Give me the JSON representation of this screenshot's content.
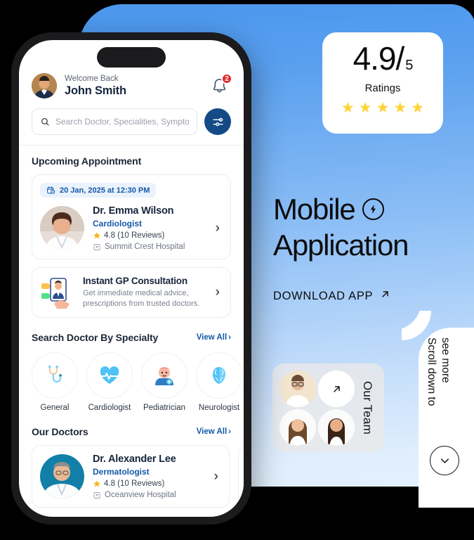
{
  "promo": {
    "ratings": {
      "score": "4.9",
      "separator": "/",
      "out_of": "5",
      "label": "Ratings",
      "stars_count": 5,
      "star_glyph": "★",
      "star_color": "#FFD233"
    },
    "headline_line1": "Mobile",
    "headline_line2": "Application",
    "headline_icon": "bolt-circle-icon",
    "download_cta": "DOWNLOAD APP",
    "download_icon": "arrow-up-right-icon",
    "team": {
      "label": "Our Team",
      "arrow_icon": "arrow-up-right-icon",
      "members": [
        "team-member-1",
        "team-member-2",
        "team-member-3"
      ]
    },
    "scroll_hint": {
      "line1": "Scroll down to",
      "line2": "see more",
      "icon": "chevron-down-icon"
    },
    "colors": {
      "gradient_top": "#4A97EE",
      "gradient_bottom": "#E4F0FD",
      "card_white": "#FFFFFF"
    }
  },
  "app": {
    "header": {
      "welcome_small": "Welcome Back",
      "user_name": "John Smith",
      "avatar": "user-avatar",
      "bell_icon": "bell-icon",
      "notification_count": "2",
      "notification_color": "#E02B2B"
    },
    "search": {
      "placeholder": "Search Doctor, Specialities, Symptoms",
      "value": "",
      "search_icon": "search-icon",
      "filter_icon": "sliders-icon",
      "filter_color": "#144A86"
    },
    "upcoming": {
      "title": "Upcoming Appointment",
      "date_chip": "20 Jan, 2025 at 12:30 PM",
      "date_icon": "calendar-clock-icon",
      "doctor": {
        "name": "Dr. Emma Wilson",
        "specialty": "Cardiologist",
        "rating": "4.8 (10 Reviews)",
        "hospital": "Summit Crest Hospital",
        "star_icon": "star-icon",
        "hospital_icon": "hospital-icon",
        "chevron": "›"
      }
    },
    "gp": {
      "title": "Instant GP Consultation",
      "subtitle_line1": "Get immediate medical advice,",
      "subtitle_line2": "prescriptions from trusted doctors.",
      "illustration": "video-consultation-icon",
      "chevron": "›"
    },
    "specialty_section": {
      "title": "Search Doctor By Specialty",
      "view_all": "View All",
      "view_all_chevron": "›",
      "items": [
        {
          "label": "General",
          "icon": "stethoscope-icon"
        },
        {
          "label": "Cardiologist",
          "icon": "heart-pulse-icon"
        },
        {
          "label": "Pediatrician",
          "icon": "baby-icon"
        },
        {
          "label": "Neurologist",
          "icon": "brain-icon"
        }
      ]
    },
    "doctors_section": {
      "title": "Our Doctors",
      "view_all": "View All",
      "view_all_chevron": "›",
      "doctors": [
        {
          "name": "Dr. Alexander Lee",
          "specialty": "Dermatologist",
          "rating": "4.8 (10 Reviews)",
          "hospital": "Oceanview Hospital",
          "chevron": "›"
        }
      ]
    }
  }
}
